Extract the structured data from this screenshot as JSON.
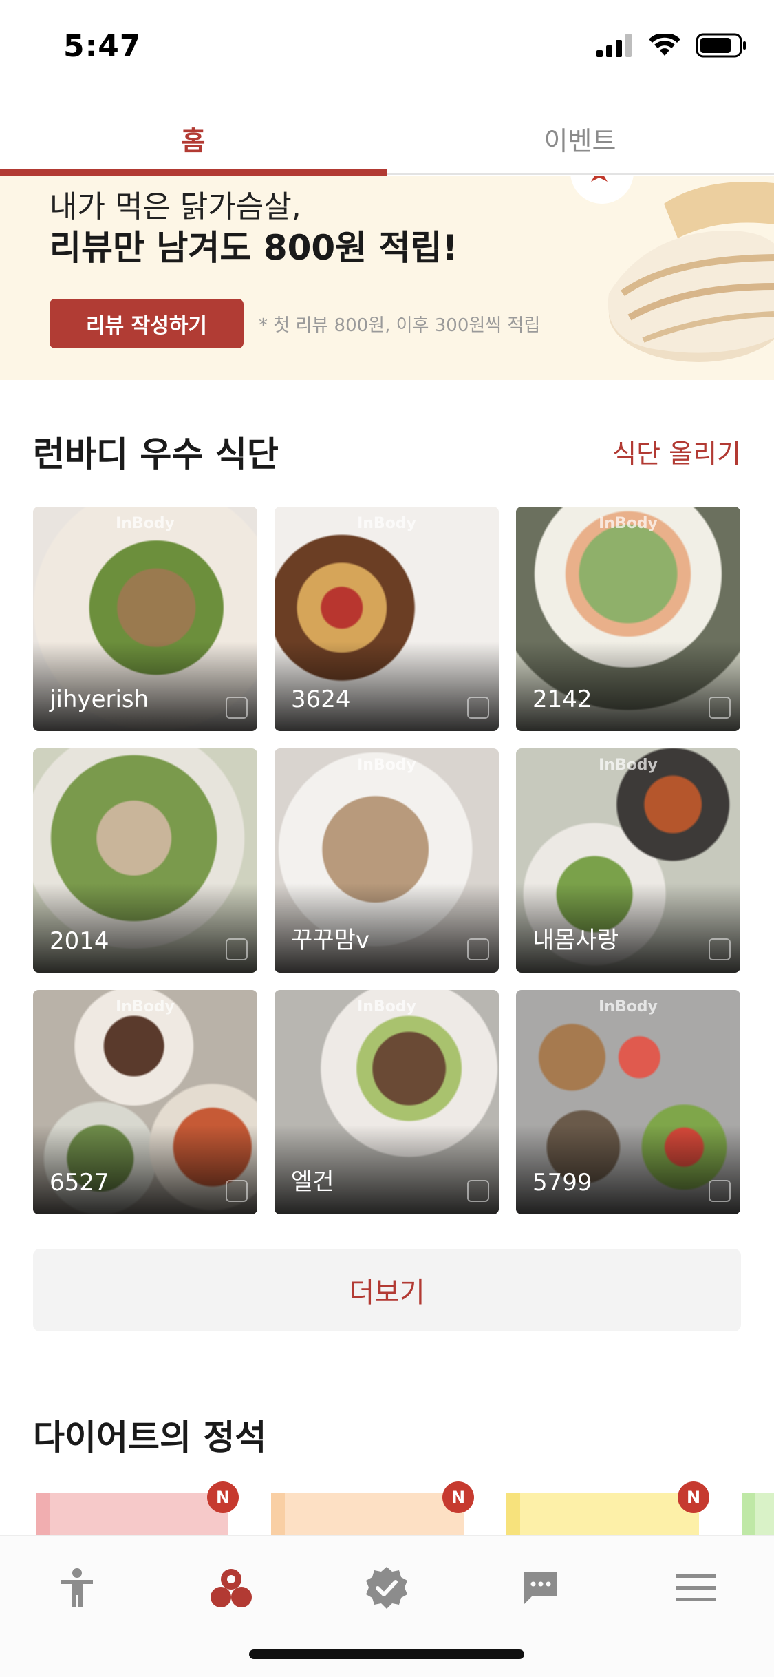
{
  "status_bar": {
    "time": "5:47"
  },
  "tabs": [
    {
      "label": "홈",
      "active": true
    },
    {
      "label": "이벤트",
      "active": false
    }
  ],
  "banner": {
    "line1": "내가 먹은 닭가슴살,",
    "line2": "리뷰만 남겨도 800원  적립!",
    "button_label": "리뷰 작성하기",
    "note": "* 첫 리뷰 800원, 이후 300원씩 적립"
  },
  "best_meals": {
    "title": "런바디 우수 식단",
    "upload_link": "식단 올리기",
    "watermark": "InBody",
    "items": [
      {
        "name": "jihyerish",
        "photo_color": "#e9e4df"
      },
      {
        "name": "3624",
        "photo_color": "#f2efec"
      },
      {
        "name": "2142",
        "photo_color": "#d9dccb"
      },
      {
        "name": "2014",
        "photo_color": "#cfd2bf"
      },
      {
        "name": "꾸꾸맘v",
        "photo_color": "#d9d4cf"
      },
      {
        "name": "내몸사랑",
        "photo_color": "#c7c9bd"
      },
      {
        "name": "6527",
        "photo_color": "#b9b2a8"
      },
      {
        "name": "엘건",
        "photo_color": "#b8b6b1"
      },
      {
        "name": "5799",
        "photo_color": "#a9a8a7"
      }
    ],
    "more_label": "더보기"
  },
  "diet_section": {
    "title": "다이어트의 정석",
    "new_badge": "N",
    "cards": [
      {
        "color": "#f6c9c9",
        "edge": "#f1aeb0"
      },
      {
        "color": "#fde0c4",
        "edge": "#f9cfa4"
      },
      {
        "color": "#fdf0a8",
        "edge": "#f7e27c"
      },
      {
        "color": "#d9f2c7",
        "edge": "#bfe8a6"
      }
    ]
  },
  "bottom_nav": {
    "items": [
      {
        "icon": "person-icon",
        "active": false
      },
      {
        "icon": "meal-icon",
        "active": true
      },
      {
        "icon": "verified-badge-icon",
        "active": false
      },
      {
        "icon": "chat-icon",
        "active": false
      },
      {
        "icon": "menu-icon",
        "active": false
      }
    ],
    "active_color": "#b23a33",
    "inactive_color": "#8c8c8c"
  }
}
